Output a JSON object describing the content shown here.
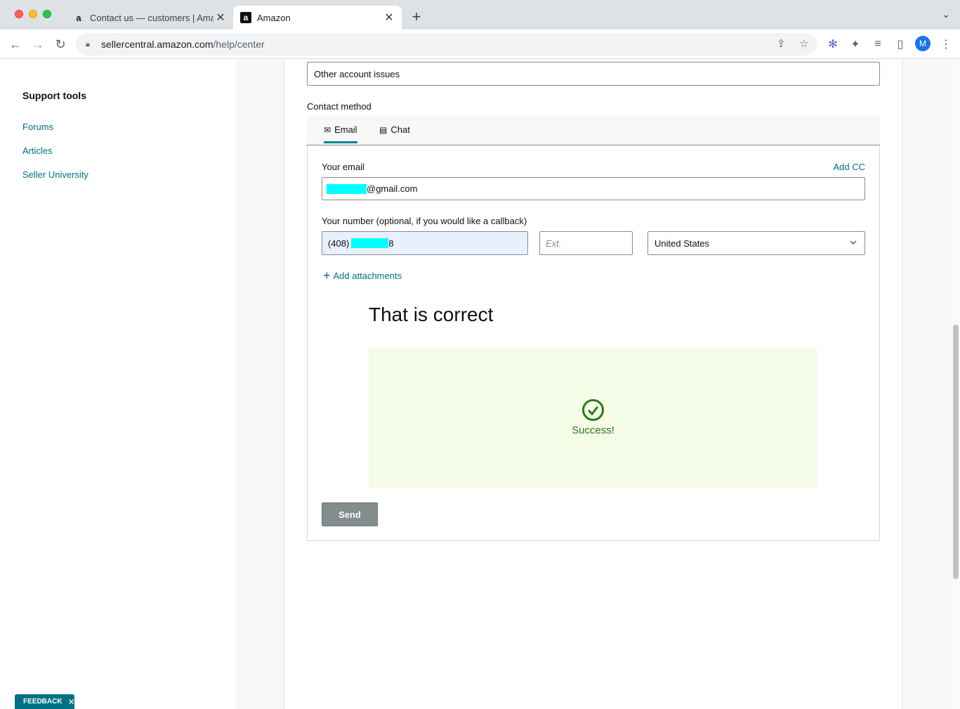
{
  "browser": {
    "tabs": [
      {
        "title": "Contact us — customers | Ama",
        "favicon": "a"
      },
      {
        "title": "Amazon",
        "favicon": "a"
      }
    ],
    "url_host": "sellercentral.amazon.com",
    "url_path": "/help/center",
    "profile_initial": "M"
  },
  "sidebar": {
    "title": "Support tools",
    "links": [
      "Forums",
      "Articles",
      "Seller University"
    ]
  },
  "form": {
    "issue_value": "Other account issues",
    "contact_method_label": "Contact method",
    "tabs": {
      "email": "Email",
      "chat": "Chat"
    },
    "email_label": "Your email",
    "add_cc": "Add CC",
    "email_suffix": "@gmail.com",
    "number_label": "Your number (optional, if you would like a callback)",
    "phone_prefix": "(408)",
    "phone_suffix": "8",
    "ext_placeholder": "Ext.",
    "country": "United States",
    "add_attachments": "Add attachments",
    "captcha_title": "That is correct",
    "success_text": "Success!",
    "send_label": "Send"
  },
  "feedback_label": "FEEDBACK",
  "colors": {
    "link": "#007185",
    "success_bg": "#f5fde9",
    "success_green": "#2a7a1b",
    "redaction": "#00ffff"
  }
}
